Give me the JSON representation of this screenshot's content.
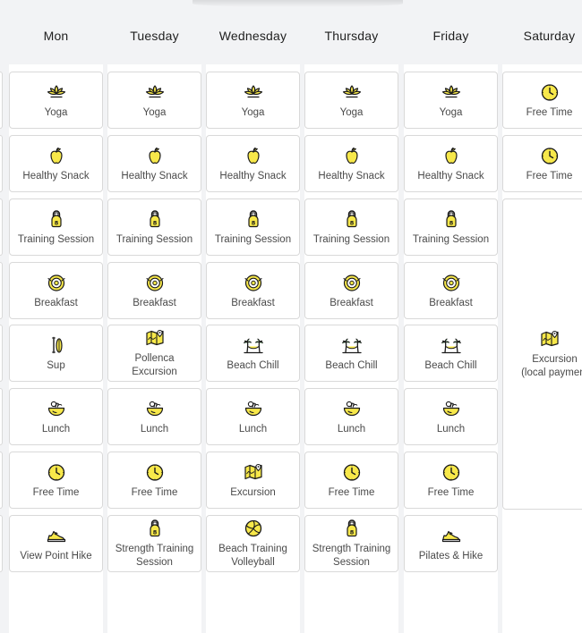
{
  "days": [
    "Mon",
    "Tuesday",
    "Wednesday",
    "Thursday",
    "Friday",
    "Saturday"
  ],
  "colors": {
    "accent": "#f7e84a",
    "stroke": "#1a1a1a",
    "border": "#d9d9d9",
    "text": "#4a4a4a"
  },
  "schedule": [
    [
      {
        "label": "Yoga",
        "icon": "lotus-icon"
      },
      {
        "label": "Healthy Snack",
        "icon": "apple-icon"
      },
      {
        "label": "Training Session",
        "icon": "kettlebell-icon"
      },
      {
        "label": "Breakfast",
        "icon": "plate-icon"
      },
      {
        "label": "Sup",
        "icon": "paddle-icon"
      },
      {
        "label": "Lunch",
        "icon": "bowl-icon"
      },
      {
        "label": "Free Time",
        "icon": "clock-icon"
      },
      {
        "label": "View Point Hike",
        "icon": "shoe-icon"
      }
    ],
    [
      {
        "label": "Yoga",
        "icon": "lotus-icon"
      },
      {
        "label": "Healthy Snack",
        "icon": "apple-icon"
      },
      {
        "label": "Training Session",
        "icon": "kettlebell-icon"
      },
      {
        "label": "Breakfast",
        "icon": "plate-icon"
      },
      {
        "label": "Pollenca\nExcursion",
        "icon": "map-icon"
      },
      {
        "label": "Lunch",
        "icon": "bowl-icon"
      },
      {
        "label": "Free Time",
        "icon": "clock-icon"
      },
      {
        "label": "Strength Training\nSession",
        "icon": "kettlebell-icon"
      }
    ],
    [
      {
        "label": "Yoga",
        "icon": "lotus-icon"
      },
      {
        "label": "Healthy Snack",
        "icon": "apple-icon"
      },
      {
        "label": "Training Session",
        "icon": "kettlebell-icon"
      },
      {
        "label": "Breakfast",
        "icon": "plate-icon"
      },
      {
        "label": "Beach Chill",
        "icon": "palm-hammock-icon"
      },
      {
        "label": "Lunch",
        "icon": "bowl-icon"
      },
      {
        "label": "Excursion",
        "icon": "map-icon"
      },
      {
        "label": "Beach Training\nVolleyball",
        "icon": "volleyball-icon"
      }
    ],
    [
      {
        "label": "Yoga",
        "icon": "lotus-icon"
      },
      {
        "label": "Healthy Snack",
        "icon": "apple-icon"
      },
      {
        "label": "Training Session",
        "icon": "kettlebell-icon"
      },
      {
        "label": "Breakfast",
        "icon": "plate-icon"
      },
      {
        "label": "Beach Chill",
        "icon": "palm-hammock-icon"
      },
      {
        "label": "Lunch",
        "icon": "bowl-icon"
      },
      {
        "label": "Free Time",
        "icon": "clock-icon"
      },
      {
        "label": "Strength Training\nSession",
        "icon": "kettlebell-icon"
      }
    ],
    [
      {
        "label": "Yoga",
        "icon": "lotus-icon"
      },
      {
        "label": "Healthy Snack",
        "icon": "apple-icon"
      },
      {
        "label": "Training Session",
        "icon": "kettlebell-icon"
      },
      {
        "label": "Breakfast",
        "icon": "plate-icon"
      },
      {
        "label": "Beach Chill",
        "icon": "palm-hammock-icon"
      },
      {
        "label": "Lunch",
        "icon": "bowl-icon"
      },
      {
        "label": "Free Time",
        "icon": "clock-icon"
      },
      {
        "label": "Pilates & Hike",
        "icon": "shoe-icon"
      }
    ],
    [
      {
        "label": "Free Time",
        "icon": "clock-icon"
      },
      {
        "label": "Free Time",
        "icon": "clock-icon"
      },
      {
        "label": "Excursion\n(local payment",
        "icon": "map-icon",
        "span": 5
      }
    ]
  ]
}
